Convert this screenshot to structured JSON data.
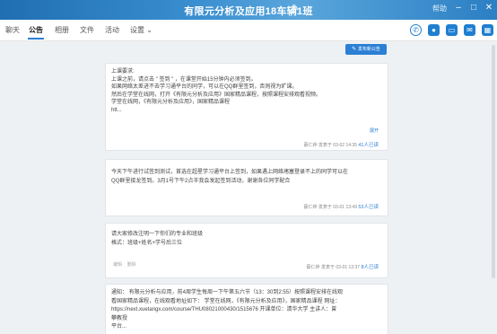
{
  "window": {
    "title": "有限元分析及应用18车辆1班",
    "help_label": "帮助"
  },
  "tabs": [
    {
      "label": "聊天"
    },
    {
      "label": "公告"
    },
    {
      "label": "相册"
    },
    {
      "label": "文件"
    },
    {
      "label": "活动"
    },
    {
      "label": "设置 ⌄"
    }
  ],
  "toolbar": {
    "post_button_label": "发布新公告"
  },
  "announcements": [
    {
      "lines": [
        "上课要求:",
        "上课之前，请点击 \" 签到 \" ，在课堂开始15分钟内必须签到。",
        "如果网络太差进不去学习通平台的同学，可以在QQ群里签到，否则视为旷课。",
        "然后在学堂在线网，打开《有限元分析及应用》国家精品课程，按照课程安排观看视频。",
        "学堂在线网，《有限元分析及应用》，国家精品课程",
        "htt..."
      ],
      "expand": "展开",
      "author": "蔡仁烨",
      "posted": "发表于 03-02 14:35",
      "read": "41人已读"
    },
    {
      "lines": [
        "今天下午进行试签到测试，首选在超星学习通平台上签到，如果遇上网络堵塞登录不上的同学可以在",
        "QQ群里接龙签到。3月1号下午2点半我会发起签到活动，谢谢各位同学配合"
      ],
      "author": "蔡仁烨",
      "posted": "发表于 03-01 13:49",
      "read": "53人已读"
    },
    {
      "lines": [
        "请大家修改注明一下你们的专业和班级",
        "格式：班级+姓名+学号后三位"
      ],
      "actions": [
        "编辑",
        "删除"
      ],
      "author": "蔡仁烨",
      "posted": "发表于 03-01 13:37",
      "read": "8人已读"
    },
    {
      "lines": [
        "通知：  有限元分析与应用，前4周学生每周一下午第五六节（13：30到2:55）按照课程安排在线观",
        "看国家精品课程，在线观看地址如下：  学堂在线网，《有限元分析及应用》，国家精品课程 网址：",
        "https://next.xuetangx.com/course/THU08021000430/1515676 开课单位：清华大学 主讲人：曾",
        "攀教授",
        "平台..."
      ]
    }
  ]
}
